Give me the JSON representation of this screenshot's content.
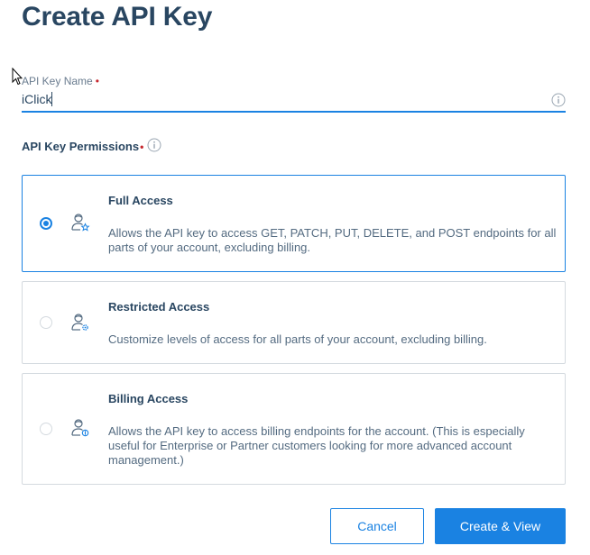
{
  "page": {
    "title": "Create API Key"
  },
  "name_field": {
    "label": "API Key Name",
    "required_marker": "•",
    "value": "iClick"
  },
  "permissions": {
    "label": "API Key Permissions",
    "required_marker": "•",
    "options": [
      {
        "title": "Full Access",
        "description": "Allows the API key to access GET, PATCH, PUT, DELETE, and POST endpoints for all parts of your account, excluding billing.",
        "selected": true,
        "icon": "user-star-icon"
      },
      {
        "title": "Restricted Access",
        "description": "Customize levels of access for all parts of your account, excluding billing.",
        "selected": false,
        "icon": "user-gear-icon"
      },
      {
        "title": "Billing Access",
        "description": "Allows the API key to access billing endpoints for the account. (This is especially useful for Enterprise or Partner customers looking for more advanced account management.)",
        "selected": false,
        "icon": "user-dollar-icon"
      }
    ]
  },
  "actions": {
    "cancel_label": "Cancel",
    "create_label": "Create & View"
  },
  "colors": {
    "accent": "#1a82e2",
    "heading": "#294661",
    "required": "#c6262d",
    "border": "#d4dadf"
  }
}
